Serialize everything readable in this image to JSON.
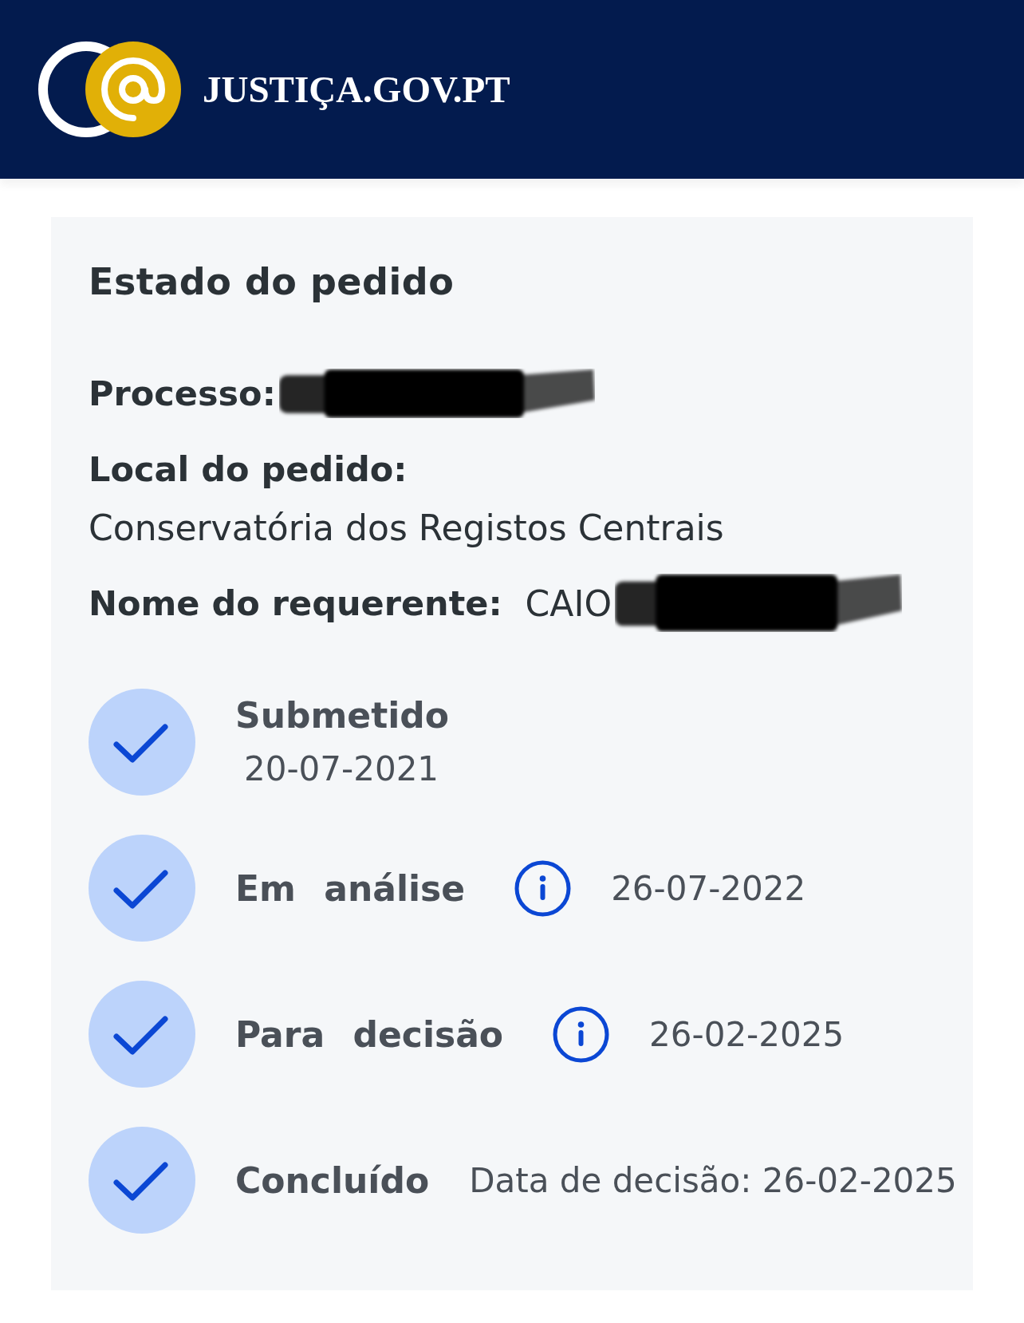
{
  "header": {
    "logo_text": "JUSTIÇA.GOV.PT"
  },
  "card": {
    "title": "Estado do pedido",
    "fields": [
      {
        "kind": "inline",
        "label": "Processo:",
        "redacted": true
      },
      {
        "kind": "stacked",
        "label": "Local do pedido:",
        "value": "Conservatória dos Registos Centrais",
        "redacted": false
      },
      {
        "kind": "inline",
        "label": "Nome do requerente:",
        "value": "CAIO",
        "redacted": true
      }
    ],
    "steps": [
      {
        "kind": "stacked",
        "label": "Submetido",
        "detail": "20-07-2021",
        "done": true,
        "info": false
      },
      {
        "kind": "inline",
        "label": "Em análise",
        "detail": "26-07-2022",
        "done": true,
        "info": true
      },
      {
        "kind": "inline",
        "label": "Para decisão",
        "detail": "26-02-2025",
        "done": true,
        "info": true
      },
      {
        "kind": "inline",
        "label": "Concluído",
        "detail": "Data de decisão: 26-02-2025",
        "done": true,
        "info": false
      }
    ]
  }
}
